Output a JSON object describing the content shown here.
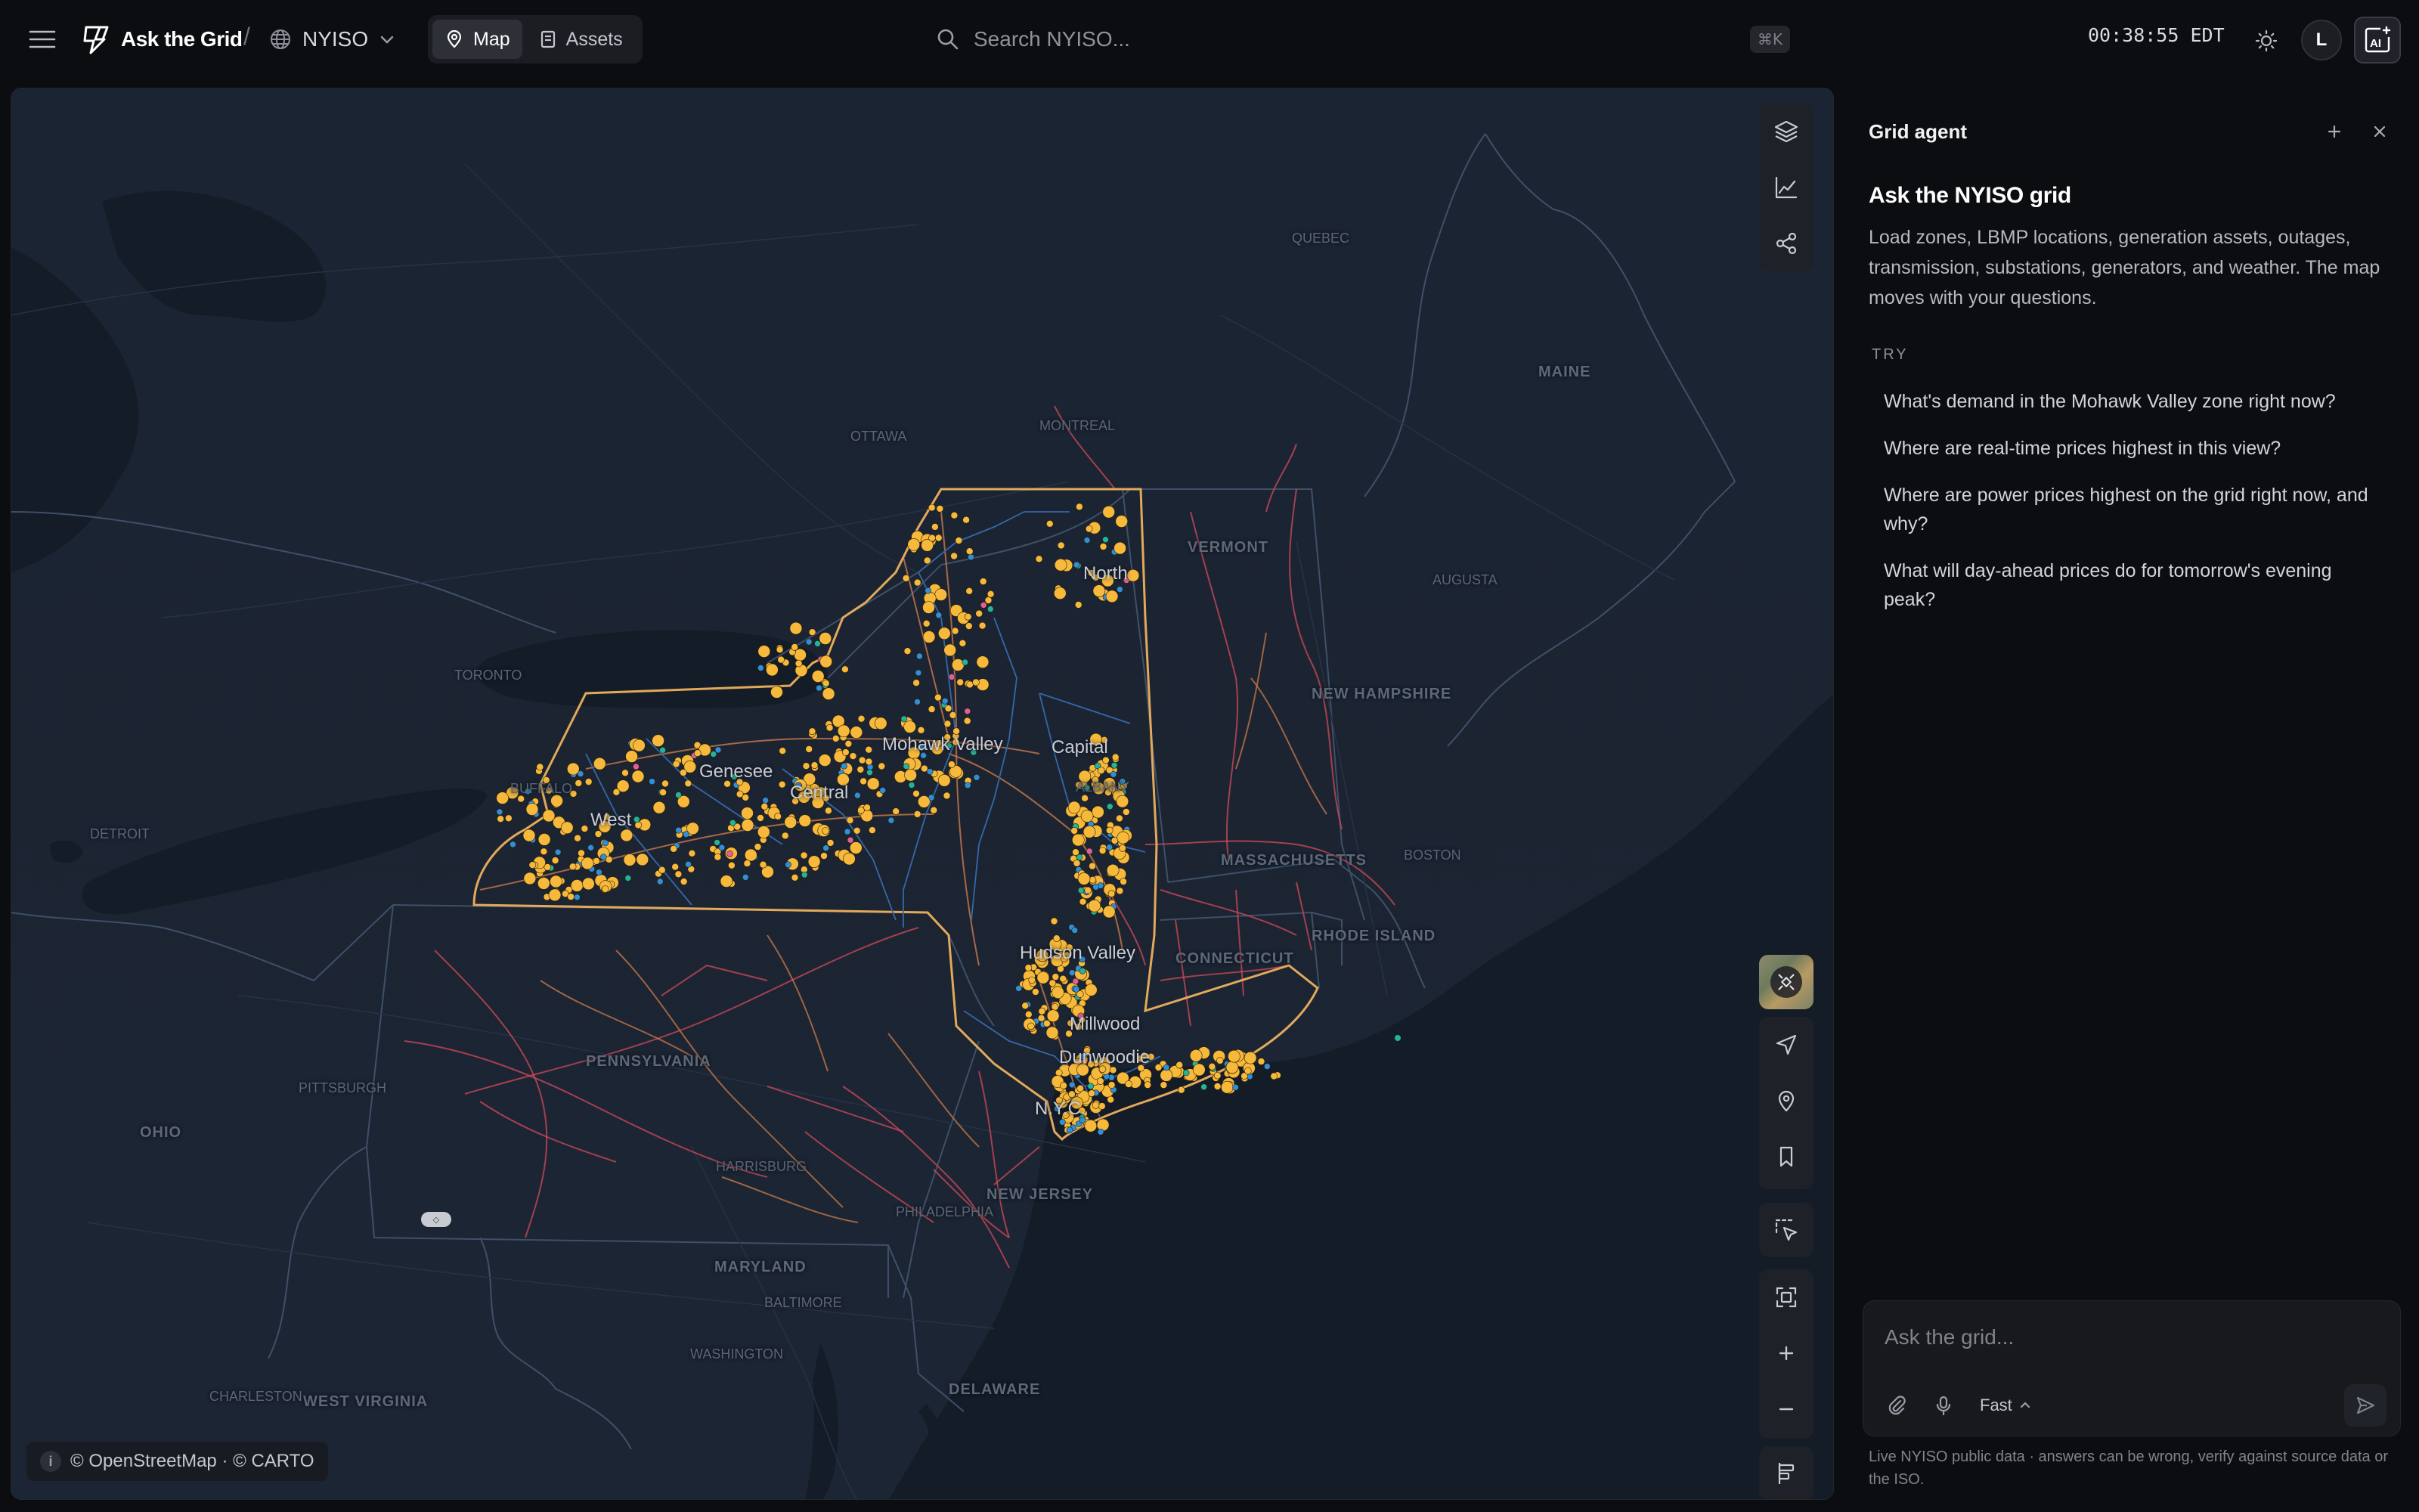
{
  "app": {
    "name": "Ask the Grid",
    "region": "NYISO"
  },
  "topbar": {
    "view_tabs": [
      {
        "label": "Map",
        "icon": "map-icon",
        "active": true
      },
      {
        "label": "Assets",
        "icon": "assets-icon",
        "active": false
      }
    ],
    "search_placeholder": "Search NYISO...",
    "search_shortcut": "⌘K",
    "clock": "00:38:55 EDT",
    "avatar_initial": "L",
    "ai_button_label": "AI"
  },
  "map": {
    "zone_labels": [
      "North",
      "Mohawk Valley",
      "Capital",
      "Genesee",
      "Central",
      "West",
      "Hudson Valley",
      "Millwood",
      "Dunwoodie",
      "N.Y.C."
    ],
    "state_labels": [
      "VERMONT",
      "NEW HAMPSHIRE",
      "MASSACHUSETTS",
      "CONNECTICUT",
      "PENNSYLVANIA",
      "NEW JERSEY",
      "MARYLAND",
      "OHIO",
      "WEST VIRGINIA",
      "MAINE",
      "DELAWARE",
      "RHODE ISLAND"
    ],
    "city_labels": [
      "TORONTO",
      "OTTAWA",
      "MONTREAL",
      "QUEBEC",
      "DETROIT",
      "BUFFALO",
      "PHILADELPHIA",
      "BALTIMORE",
      "WASHINGTON",
      "AUGUSTA",
      "CHARLESTON",
      "HARRISBURG",
      "PITTSBURGH",
      "BOSTON",
      "ALBANY"
    ],
    "attribution": "© OpenStreetMap · © CARTO",
    "info_glyph": "i",
    "colors": {
      "background": "#1a2331",
      "nyiso_boundary": "#e2a95a",
      "generator": "#f6b93b",
      "lbmp_node": "#2f8fd8",
      "transmission_red": "#d24a5a",
      "transmission_orange": "#c97a4a",
      "outage": "#e0609a",
      "substation": "#22b39a"
    }
  },
  "panel": {
    "title": "Grid agent",
    "hero_title": "Ask the NYISO grid",
    "hero_desc": "Load zones, LBMP locations, generation assets, outages, transmission, substations, generators, and weather. The map moves with your questions.",
    "try_label": "TRY",
    "suggestions": [
      "What's demand in the Mohawk Valley zone right now?",
      "Where are real-time prices highest in this view?",
      "Where are power prices highest on the grid right now, and why?",
      "What will day-ahead prices do for tomorrow's evening peak?"
    ],
    "composer_placeholder": "Ask the grid...",
    "mode": "Fast",
    "disclaimer": "Live NYISO public data · answers can be wrong, verify against source data or the ISO."
  }
}
